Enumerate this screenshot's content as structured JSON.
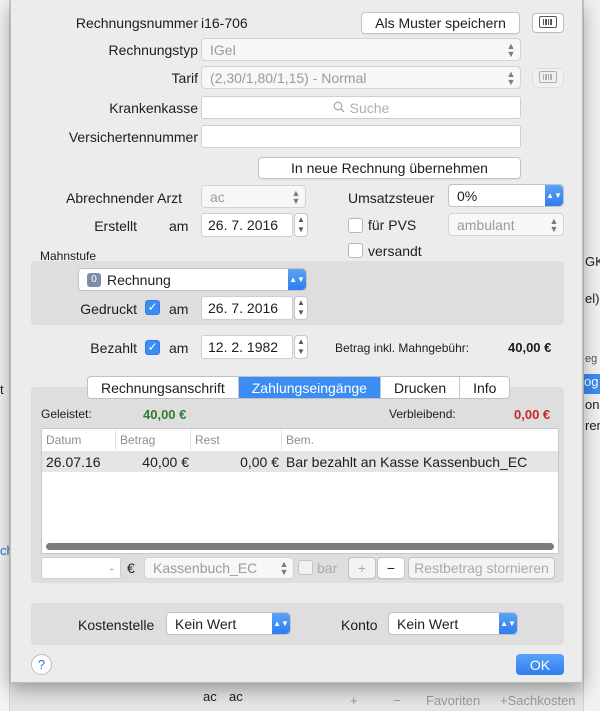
{
  "background": {
    "left_fragments": [
      "t",
      "ch"
    ],
    "right_fragments": [
      "GK",
      "el)",
      "eg",
      "og",
      "ons",
      "ren"
    ],
    "bottom": {
      "cells": [
        "ac",
        "ac"
      ],
      "plus": "+",
      "minus": "−",
      "favorites": "Favoriten",
      "sachkosten": "+Sachkosten"
    }
  },
  "invoice": {
    "number_label": "Rechnungsnummer",
    "number_value": "i16-706",
    "template_button": "Als Muster speichern",
    "type_label": "Rechnungstyp",
    "type_value": "IGel",
    "tariff_label": "Tarif",
    "tariff_value": "(2,30/1,80/1,15)  -  Normal",
    "insurance_label": "Krankenkasse",
    "insurance_placeholder": "Suche",
    "insured_number_label": "Versichertennummer",
    "insured_number_value": "",
    "transfer_button": "In neue Rechnung übernehmen"
  },
  "details": {
    "doctor_label": "Abrechnender Arzt",
    "doctor_value": "ac",
    "vat_label": "Umsatzsteuer",
    "vat_value": "0%",
    "created_label": "Erstellt",
    "am": "am",
    "created_date": "26. 7. 2016",
    "pvs_label": "für PVS",
    "pvs_value": "ambulant",
    "sent_label": "versandt",
    "dunning_label": "Mahnstufe",
    "dunning_badge": "0",
    "dunning_value": "Rechnung",
    "printed_label": "Gedruckt",
    "printed_date": "26. 7. 2016",
    "paid_label": "Bezahlt",
    "paid_date": "12. 2. 1982",
    "amount_label": "Betrag inkl. Mahngebühr:",
    "amount_value": "40,00 €"
  },
  "tabs": [
    {
      "label": "Rechnungsanschrift",
      "selected": false
    },
    {
      "label": "Zahlungseingänge",
      "selected": true
    },
    {
      "label": "Drucken",
      "selected": false
    },
    {
      "label": "Info",
      "selected": false
    }
  ],
  "payments": {
    "paid_label": "Geleistet:",
    "paid_value": "40,00 €",
    "remaining_label": "Verbleibend:",
    "remaining_value": "0,00 €",
    "columns": [
      "Datum",
      "Betrag",
      "Rest",
      "Bem."
    ],
    "rows": [
      {
        "date": "26.07.16",
        "amount": "40,00 €",
        "rest": "0,00 €",
        "note": "Bar bezahlt an Kasse Kassenbuch_EC"
      }
    ],
    "amount_input": "",
    "amount_input_suffix": "-",
    "currency": "€",
    "cashbook_value": "Kassenbuch_EC",
    "cash_label": "bar",
    "add": "+",
    "remove": "−",
    "cancel_rest_button": "Restbetrag stornieren"
  },
  "footer": {
    "cost_center_label": "Kostenstelle",
    "cost_center_value": "Kein Wert",
    "account_label": "Konto",
    "account_value": "Kein Wert",
    "help": "?",
    "ok_button": "OK"
  },
  "colors": {
    "accent": "#3b8df3",
    "paid_green": "#2e7d32",
    "remaining_red": "#c62828"
  }
}
